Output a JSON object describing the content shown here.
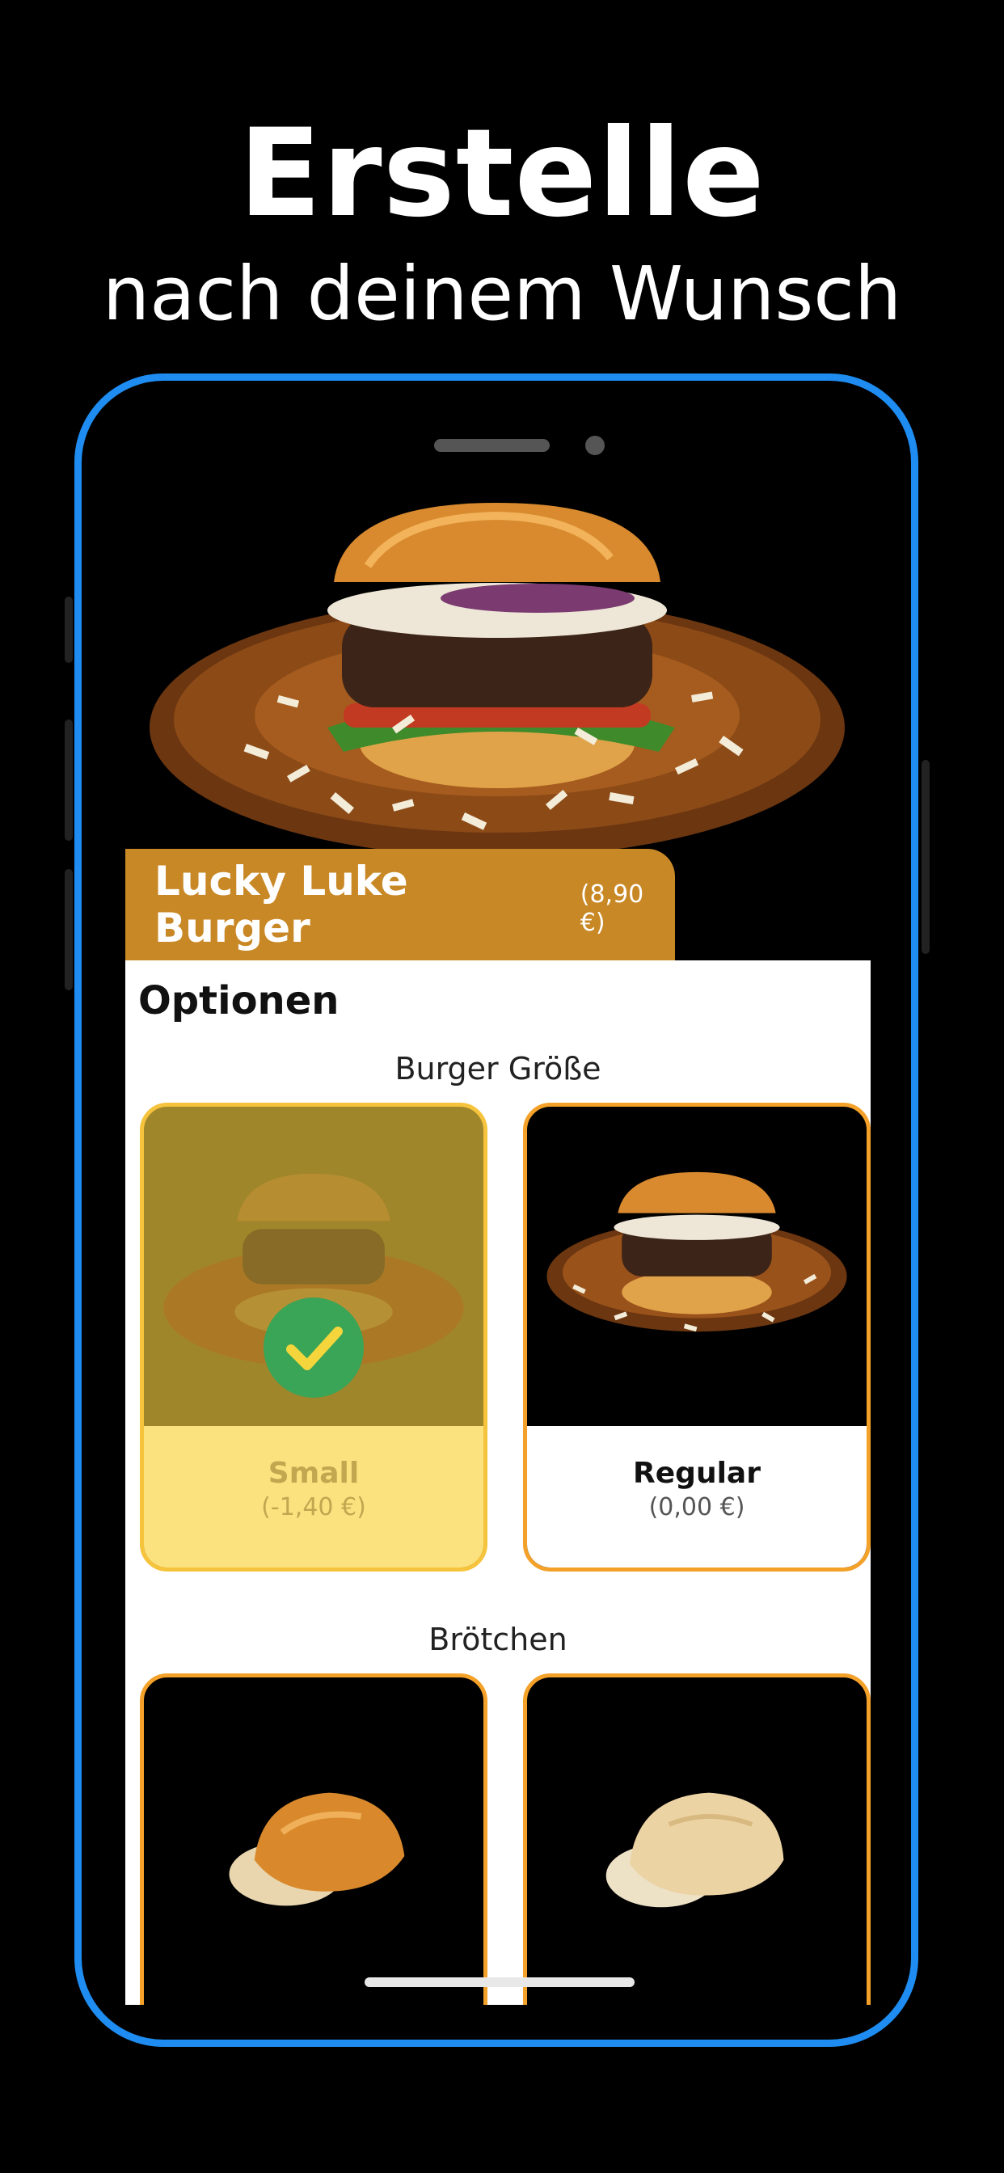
{
  "promo": {
    "headline": "Erstelle",
    "subheadline": "nach deinem Wunsch"
  },
  "product": {
    "name": "Lucky Luke Burger",
    "price": "(8,90 €)"
  },
  "options": {
    "title": "Optionen",
    "groups": [
      {
        "label": "Burger Größe",
        "items": [
          {
            "name": "Small",
            "price": "(-1,40 €)",
            "selected": true,
            "image": "burger-photo"
          },
          {
            "name": "Regular",
            "price": "(0,00 €)",
            "selected": false,
            "image": "burger-photo"
          }
        ]
      },
      {
        "label": "Brötchen",
        "items": [
          {
            "image": "brioche-bun-photo"
          },
          {
            "image": "white-bun-photo"
          }
        ]
      }
    ]
  },
  "colors": {
    "background": "#000000",
    "phone_frame": "#1e8cf0",
    "accent": "#c98826",
    "card_border": "#f4a12a",
    "selected_fill": "#fce27f",
    "check": "#3aa457"
  }
}
